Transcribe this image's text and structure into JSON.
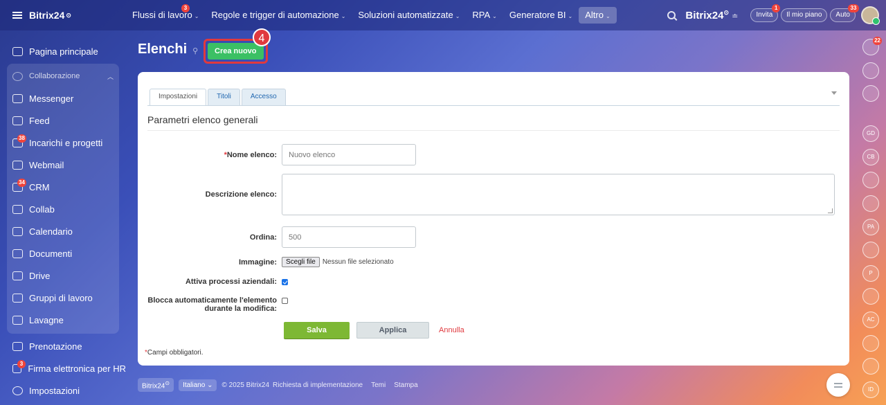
{
  "brand": {
    "name": "Bitrix24",
    "clock_glyph": "⊙"
  },
  "topnav": [
    {
      "label": "Flussi di lavoro",
      "badge": "3",
      "active": false
    },
    {
      "label": "Regole e trigger di automazione",
      "badge": "",
      "active": false
    },
    {
      "label": "Soluzioni automatizzate",
      "badge": "",
      "active": false
    },
    {
      "label": "RPA",
      "badge": "",
      "active": false
    },
    {
      "label": "Generatore BI",
      "badge": "",
      "active": false
    },
    {
      "label": "Altro",
      "badge": "",
      "active": true
    }
  ],
  "topright": {
    "logo": "Bitrix24",
    "clock_glyph": "⊙",
    "settings_glyph": "≐",
    "invite": {
      "label": "Invita",
      "badge": "1"
    },
    "plan": {
      "label": "Il mio piano"
    },
    "auto": {
      "label": "Auto",
      "badge": "33"
    }
  },
  "sidebar": {
    "items": [
      {
        "name": "home",
        "label": "Pagina principale",
        "badge": ""
      }
    ],
    "group": {
      "label": "Collaborazione",
      "items": [
        {
          "name": "messenger",
          "label": "Messenger",
          "badge": ""
        },
        {
          "name": "feed",
          "label": "Feed",
          "badge": ""
        },
        {
          "name": "tasks",
          "label": "Incarichi e progetti",
          "badge": "38"
        },
        {
          "name": "webmail",
          "label": "Webmail",
          "badge": ""
        },
        {
          "name": "crm",
          "label": "CRM",
          "badge": "34"
        },
        {
          "name": "collab",
          "label": "Collab",
          "badge": ""
        },
        {
          "name": "calendar",
          "label": "Calendario",
          "badge": ""
        },
        {
          "name": "documents",
          "label": "Documenti",
          "badge": ""
        },
        {
          "name": "drive",
          "label": "Drive",
          "badge": ""
        },
        {
          "name": "workgroups",
          "label": "Gruppi di lavoro",
          "badge": ""
        },
        {
          "name": "boards",
          "label": "Lavagne",
          "badge": ""
        }
      ]
    },
    "after": [
      {
        "name": "booking",
        "label": "Prenotazione",
        "badge": ""
      },
      {
        "name": "hr-sign",
        "label": "Firma elettronica per HR",
        "badge": "3"
      }
    ],
    "settings": "Impostazioni"
  },
  "page": {
    "title": "Elenchi",
    "pin_glyph": "⚲",
    "create_label": "Crea nuovo",
    "step_number": "4"
  },
  "form": {
    "tabs": [
      {
        "label": "Impostazioni",
        "active": true
      },
      {
        "label": "Titoli",
        "active": false
      },
      {
        "label": "Accesso",
        "active": false
      }
    ],
    "section_title": "Parametri elenco generali",
    "required_mark": "*",
    "name_label": "Nome elenco:",
    "name_value": "Nuovo elenco",
    "description_label": "Descrizione elenco:",
    "description_value": "",
    "order_label": "Ordina:",
    "order_value": "500",
    "image_label": "Immagine:",
    "file_button": "Scegli file",
    "file_status": "Nessun file selezionato",
    "bp_label": "Attiva processi aziendali:",
    "bp_checked": true,
    "lock_label_1": "Blocca automaticamente l'elemento",
    "lock_label_2": "durante la modifica:",
    "lock_checked": false,
    "save": "Salva",
    "apply": "Applica",
    "cancel": "Annulla",
    "required_note": "Campi obbligatori."
  },
  "footer": {
    "brand": "Bitrix24",
    "clock_glyph": "⊙",
    "language": "Italiano",
    "language_caret": "⌄",
    "copyright": "© 2025 Bitrix24",
    "links": [
      "Richiesta di implementazione",
      "Temi",
      "Stampa"
    ]
  },
  "rightbar": [
    {
      "name": "notifications",
      "text": "",
      "badge": "22"
    },
    {
      "name": "copilot",
      "text": "",
      "badge": ""
    },
    {
      "name": "search-chats",
      "text": "",
      "badge": ""
    },
    {
      "name": "chat-gd",
      "text": "GD",
      "badge": ""
    },
    {
      "name": "chat-cb",
      "text": "CB",
      "badge": ""
    },
    {
      "name": "chat-group-1",
      "text": "",
      "badge": ""
    },
    {
      "name": "chat-group-2",
      "text": "",
      "badge": ""
    },
    {
      "name": "chat-pa",
      "text": "PA",
      "badge": ""
    },
    {
      "name": "chat-copilot",
      "text": "",
      "badge": ""
    },
    {
      "name": "chat-p",
      "text": "P",
      "badge": ""
    },
    {
      "name": "chat-tasks",
      "text": "",
      "badge": ""
    },
    {
      "name": "chat-ac",
      "text": "AC",
      "badge": ""
    },
    {
      "name": "video-1",
      "text": "",
      "badge": ""
    },
    {
      "name": "video-2",
      "text": "",
      "badge": ""
    },
    {
      "name": "chat-id",
      "text": "ID",
      "badge": ""
    }
  ]
}
